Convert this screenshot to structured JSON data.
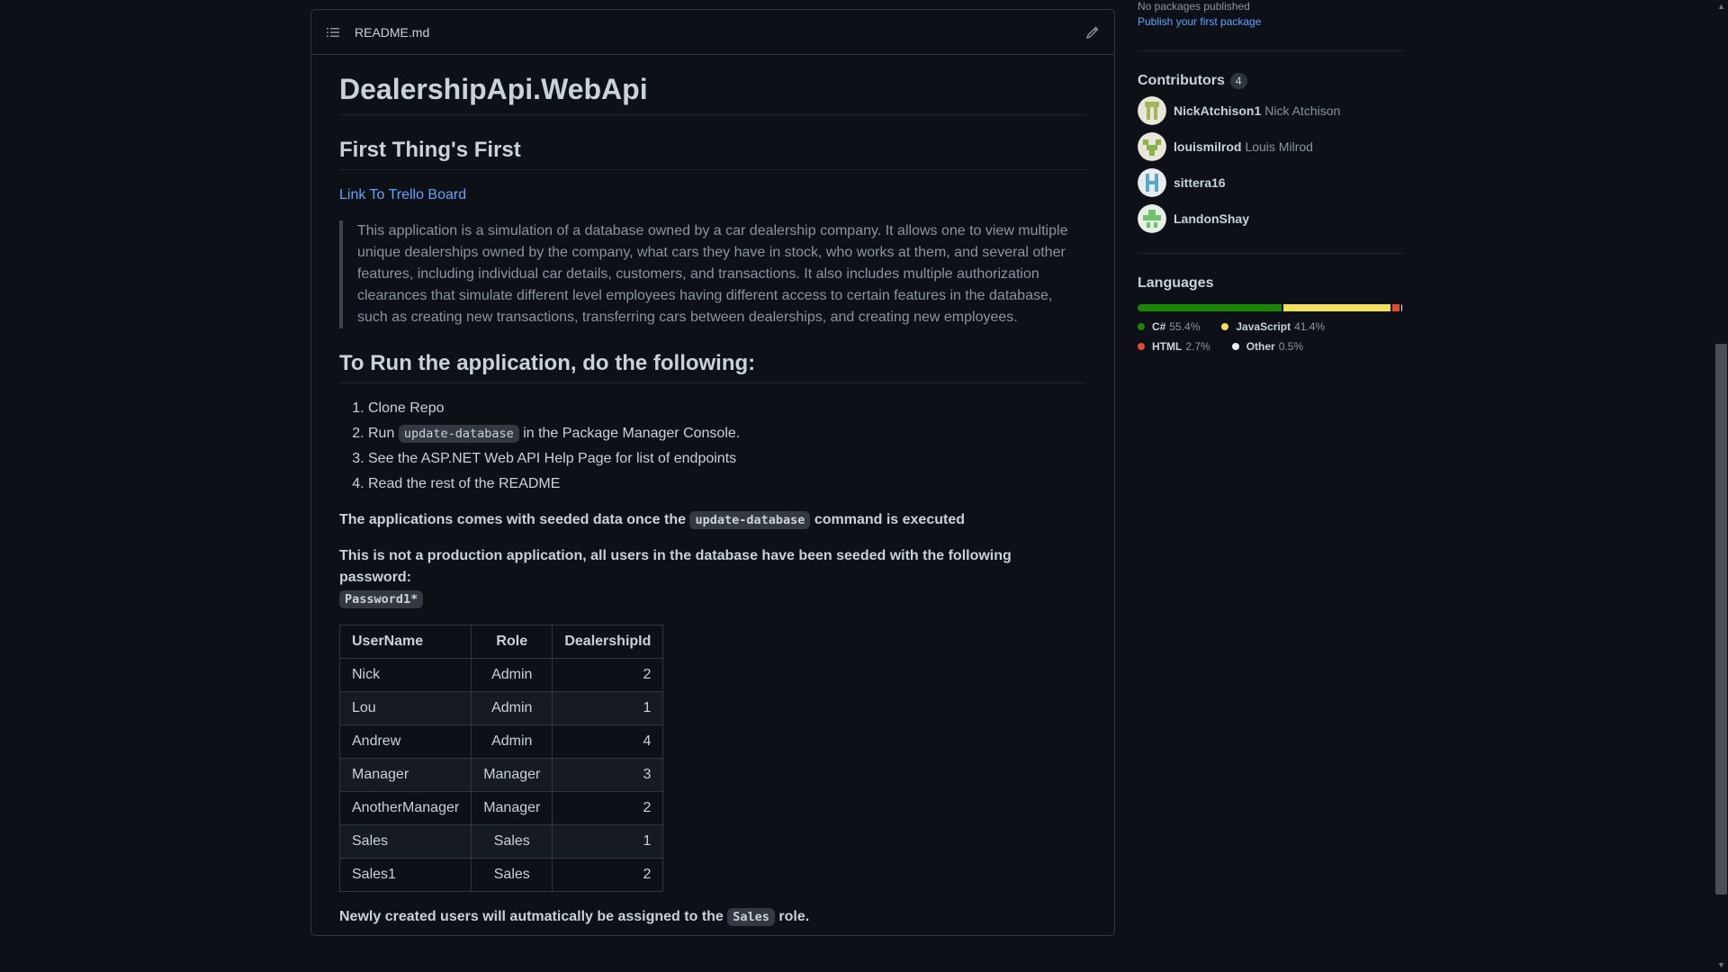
{
  "readme": {
    "filename": "README.md",
    "title": "DealershipApi.WebApi",
    "section1": "First Thing's First",
    "trello_link": "Link To Trello Board",
    "description": "This application is a simulation of a database owned by a car dealership company. It allows one to view multiple unique dealerships owned by the company, what cars they have in stock, who works at them, and several other features, including individual car details, customers, and transactions. It also includes multiple authorization clearances that simulate different level employees having different access to certain features in the database, such as creating new transactions, transferring cars between dealerships, and creating new employees.",
    "section2": "To Run the application, do the following:",
    "steps": {
      "s1": "Clone Repo",
      "s2_prefix": "Run",
      "s2_code": "update-database",
      "s2_suffix": "in the Package Manager Console.",
      "s3": "See the ASP.NET Web API Help Page for list of endpoints",
      "s4": "Read the rest of the README"
    },
    "seeded_prefix": "The applications comes with seeded data once the",
    "seeded_code": "update-database",
    "seeded_suffix": "command is executed",
    "password_text": "This is not a production application, all users in the database have been seeded with the following password:",
    "password_code": "Password1*",
    "table": {
      "headers": [
        "UserName",
        "Role",
        "DealershipId"
      ],
      "rows": [
        [
          "Nick",
          "Admin",
          "2"
        ],
        [
          "Lou",
          "Admin",
          "1"
        ],
        [
          "Andrew",
          "Admin",
          "4"
        ],
        [
          "Manager",
          "Manager",
          "3"
        ],
        [
          "AnotherManager",
          "Manager",
          "2"
        ],
        [
          "Sales",
          "Sales",
          "1"
        ],
        [
          "Sales1",
          "Sales",
          "2"
        ]
      ]
    },
    "new_users_prefix": "Newly created users will autmatically be assigned to the",
    "new_users_code": "Sales",
    "new_users_suffix": "role."
  },
  "sidebar": {
    "packages_none": "No packages published",
    "packages_link": "Publish your first package",
    "contributors_title": "Contributors",
    "contributors_count": "4",
    "contributors": [
      {
        "login": "NickAtchison1",
        "name": "Nick Atchison"
      },
      {
        "login": "louismilrod",
        "name": "Louis Milrod"
      },
      {
        "login": "sittera16",
        "name": ""
      },
      {
        "login": "LandonShay",
        "name": ""
      }
    ],
    "languages_title": "Languages",
    "languages": [
      {
        "name": "C#",
        "pct": "55.4%",
        "value": 55.4,
        "color": "#178600"
      },
      {
        "name": "JavaScript",
        "pct": "41.4%",
        "value": 41.4,
        "color": "#f1e05a"
      },
      {
        "name": "HTML",
        "pct": "2.7%",
        "value": 2.7,
        "color": "#e34c26"
      },
      {
        "name": "Other",
        "pct": "0.5%",
        "value": 0.5,
        "color": "#ededed"
      }
    ]
  },
  "colors": {
    "background": "#0d1117",
    "link": "#58a6ff",
    "border": "#30363d"
  }
}
